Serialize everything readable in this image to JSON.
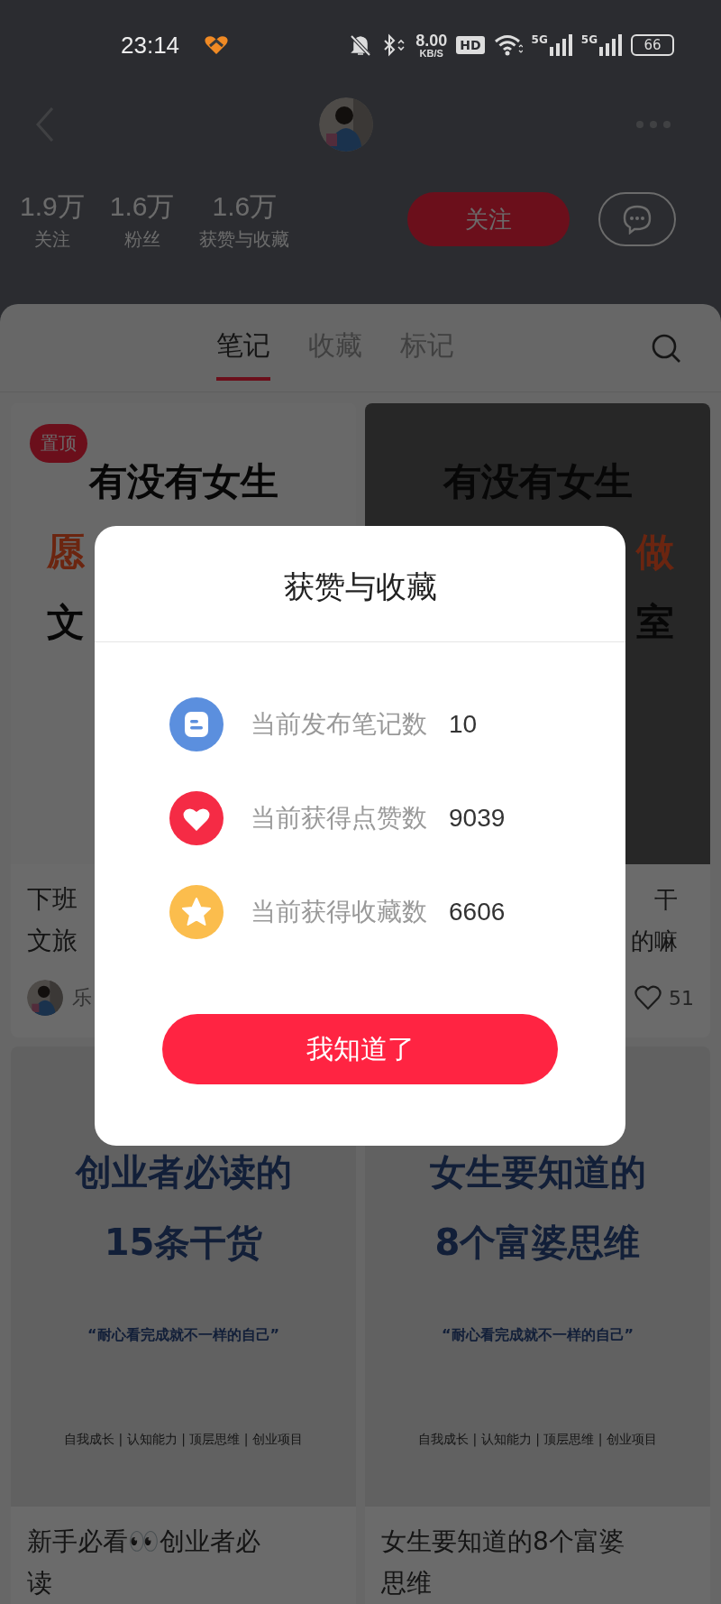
{
  "status_bar": {
    "time": "23:14",
    "speed": "8.00",
    "speed_unit": "KB/S",
    "hd": "HD",
    "networks": [
      "5G",
      "5G"
    ],
    "battery": "66"
  },
  "profile": {
    "stats": [
      {
        "value": "1.9万",
        "label": "关注"
      },
      {
        "value": "1.6万",
        "label": "粉丝"
      },
      {
        "value": "1.6万",
        "label": "获赞与收藏"
      }
    ],
    "follow_button": "关注"
  },
  "tabs": [
    {
      "label": "笔记",
      "selected": true
    },
    {
      "label": "收藏",
      "selected": false
    },
    {
      "label": "标记",
      "selected": false
    }
  ],
  "notes": [
    {
      "badge": "置顶",
      "cover": {
        "kind": "light",
        "lines": [
          {
            "text": "有没有女生",
            "kind": "full",
            "accent": false
          },
          {
            "text": "愿",
            "kind": "left_part",
            "accent": true
          },
          {
            "text": "文",
            "kind": "left_part",
            "accent": false
          }
        ]
      },
      "title_lines": [
        {
          "text": "下班",
          "kind": "left_part"
        },
        {
          "text": "文旅",
          "kind": "left_part"
        }
      ],
      "author": "乐"
    },
    {
      "cover": {
        "kind": "dark",
        "lines": [
          {
            "text": "有没有女生",
            "kind": "full",
            "accent": false
          },
          {
            "text": "做",
            "kind": "right_part",
            "accent": true
          },
          {
            "text": "室",
            "kind": "right_part",
            "accent": false
          }
        ]
      },
      "title_lines": [
        {
          "text": "干",
          "kind": "right_part"
        },
        {
          "text": "的嘛",
          "kind": "right_part"
        }
      ],
      "likes": "51"
    },
    {
      "cover": {
        "kind": "poster",
        "lines": [
          {
            "text": "创业者必读的",
            "kind": "headline"
          },
          {
            "text": "15条干货",
            "kind": "headline"
          },
          {
            "text": "“耐心看完成就不一样的自己”",
            "kind": "quote"
          },
          {
            "text": "自我成长 | 认知能力 | 顶层思维 | 创业项目",
            "kind": "tags"
          }
        ]
      },
      "title_lines": [
        {
          "text": "新手必看👀创业者必",
          "kind": "full"
        },
        {
          "text": "读",
          "kind": "full"
        }
      ]
    },
    {
      "cover": {
        "kind": "poster",
        "lines": [
          {
            "text": "女生要知道的",
            "kind": "headline"
          },
          {
            "text": "8个富婆思维",
            "kind": "headline"
          },
          {
            "text": "“耐心看完成就不一样的自己”",
            "kind": "quote"
          },
          {
            "text": "自我成长 | 认知能力 | 顶层思维 | 创业项目",
            "kind": "tags"
          }
        ]
      },
      "title_lines": [
        {
          "text": "女生要知道的8个富婆",
          "kind": "full"
        },
        {
          "text": "思维",
          "kind": "full"
        }
      ]
    }
  ],
  "dialog": {
    "title": "获赞与收藏",
    "rows": [
      {
        "kind": "notes",
        "label": "当前发布笔记数",
        "value": "10"
      },
      {
        "kind": "likes",
        "label": "当前获得点赞数",
        "value": "9039"
      },
      {
        "kind": "favorites",
        "label": "当前获得收藏数",
        "value": "6606"
      }
    ],
    "button": "我知道了"
  }
}
